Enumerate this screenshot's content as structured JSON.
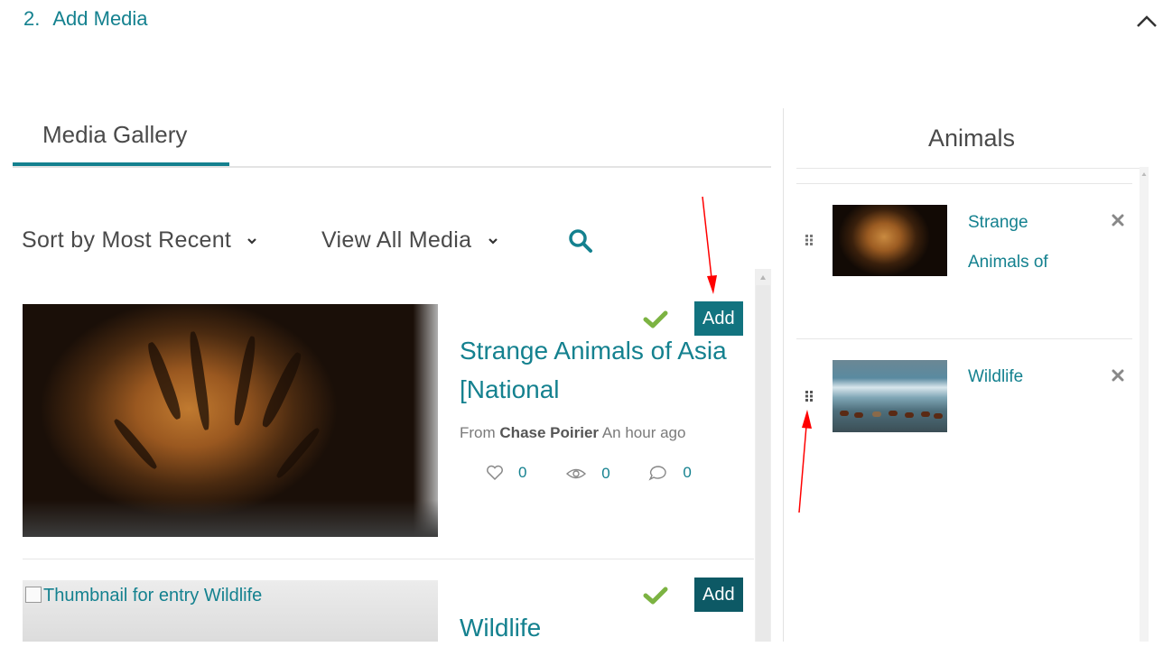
{
  "header": {
    "step_number": "2.",
    "step_title": "Add Media"
  },
  "gallery": {
    "tab_label": "Media Gallery",
    "sort_label": "Sort by Most Recent",
    "filter_label": "View All Media",
    "entries": [
      {
        "title": "Strange Animals of Asia [National",
        "add_label": "Add",
        "from_label": "From",
        "author": "Chase Poirier",
        "time": "An hour ago",
        "likes": "0",
        "views": "0",
        "comments": "0"
      },
      {
        "thumbnail_alt": "Thumbnail for entry Wildlife",
        "title": "Wildlife",
        "add_label": "Add"
      }
    ]
  },
  "playlist": {
    "title": "Animals",
    "items": [
      {
        "title": "Strange Animals of"
      },
      {
        "title": "Wildlife"
      }
    ]
  },
  "colors": {
    "accent": "#14818f",
    "add_button": "#12737f",
    "check": "#7cb342",
    "annotation_arrow": "#ff0000"
  }
}
